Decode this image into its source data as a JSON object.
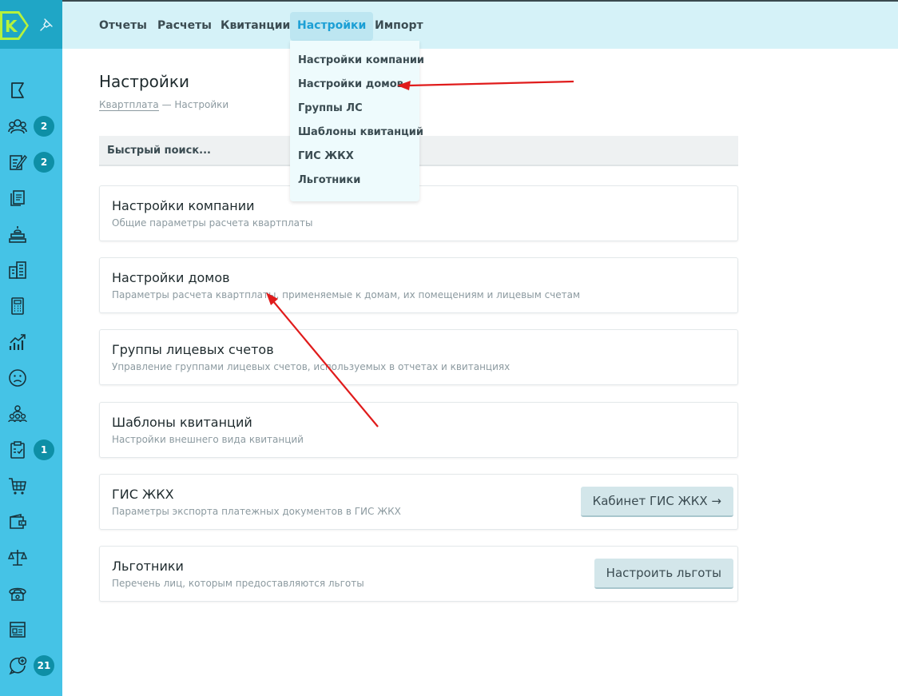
{
  "sidebar": {
    "logo_letter": "K",
    "badges": {
      "residents": "2",
      "requests": "2",
      "tasks": "1",
      "chat": "21"
    },
    "icons": [
      "flag-icon",
      "residents-icon",
      "requests-icon",
      "documents-icon",
      "dispatcher-icon",
      "buildings-icon",
      "calculator-icon",
      "analytics-icon",
      "complaints-icon",
      "staff-icon",
      "tasks-icon",
      "cart-icon",
      "wallet-icon",
      "legal-icon",
      "phone-icon",
      "receipts-icon",
      "chat-icon"
    ]
  },
  "topnav": {
    "tabs": [
      {
        "label": "Отчеты"
      },
      {
        "label": "Расчеты"
      },
      {
        "label": "Квитанции"
      },
      {
        "label": "Настройки"
      },
      {
        "label": "Импорт"
      }
    ],
    "active_tab": "Настройки"
  },
  "dropdown": {
    "items": [
      {
        "label": "Настройки компании"
      },
      {
        "label": "Настройки домов"
      },
      {
        "label": "Группы ЛС"
      },
      {
        "label": "Шаблоны квитанций"
      },
      {
        "label": "ГИС ЖКХ"
      },
      {
        "label": "Льготники"
      }
    ]
  },
  "page": {
    "title": "Настройки",
    "breadcrumb": {
      "root": "Квартплата",
      "separator": " — ",
      "current": "Настройки"
    },
    "search_placeholder": "Быстрый поиск..."
  },
  "cards": [
    {
      "title": "Настройки компании",
      "description": "Общие параметры расчета квартплаты"
    },
    {
      "title": "Настройки домов",
      "description": "Параметры расчета квартплаты, применяемые к домам, их помещениям и лицевым счетам"
    },
    {
      "title": "Группы лицевых счетов",
      "description": "Управление группами лицевых счетов, используемых в отчетах и квитанциях"
    },
    {
      "title": "Шаблоны квитанций",
      "description": "Настройки внешнего вида квитанций"
    },
    {
      "title": "ГИС ЖКХ",
      "description": "Параметры экспорта платежных документов в ГИС ЖКХ",
      "button": "Кабинет ГИС ЖКХ →"
    },
    {
      "title": "Льготники",
      "description": "Перечень лиц, которым предоставляются льготы",
      "button": "Настроить льготы"
    }
  ],
  "colors": {
    "sidebar": "#45c3e6",
    "logo_bg": "#1fa6c6",
    "badge": "#0e8fa6",
    "topbar": "#d5f2f8",
    "active_tab_text": "#1c9fd5",
    "annotation_arrow": "#e01b1b"
  }
}
